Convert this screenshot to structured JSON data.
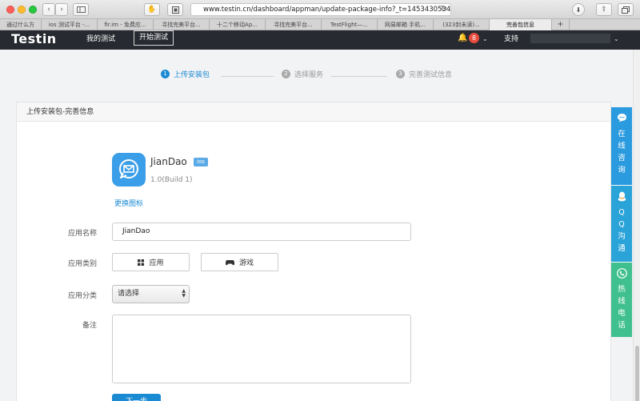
{
  "browser": {
    "url": "www.testin.cn/dashboard/appman/update-package-info?_t=1453430534&app_",
    "tabs": [
      {
        "label": "通过什么方",
        "width": 52
      },
      {
        "label": "ios 测试平台 -...",
        "width": 70
      },
      {
        "label": "fir.im - 免费应...",
        "width": 70
      },
      {
        "label": "寻找完美平台...",
        "width": 70
      },
      {
        "label": "十二个移动Ap...",
        "width": 70
      },
      {
        "label": "寻找完美平台...",
        "width": 70
      },
      {
        "label": "TestFlight—...",
        "width": 70
      },
      {
        "label": "网易邮箱 手机...",
        "width": 70
      },
      {
        "label": "(323封未读)...",
        "width": 70
      },
      {
        "label": "完善包信息",
        "width": 78,
        "active": true
      }
    ],
    "new_tab": "+"
  },
  "header": {
    "logo": "Testin",
    "my_tests": "我的测试",
    "start_test": "开始测试",
    "notification_count": "8",
    "support": "支持"
  },
  "steps": [
    {
      "num": "1",
      "label": "上传安装包",
      "active": true
    },
    {
      "num": "2",
      "label": "选择服务",
      "active": false
    },
    {
      "num": "3",
      "label": "完善测试信息",
      "active": false
    }
  ],
  "panel": {
    "title": "上传安装包-完善信息",
    "app_name": "JianDao",
    "platform_tag": "ios",
    "version": "1.0(Build 1)",
    "change_icon": "更换图标",
    "form": {
      "name_label": "应用名称",
      "name_value": "JianDao",
      "category_label": "应用类别",
      "category_app": "应用",
      "category_game": "游戏",
      "classify_label": "应用分类",
      "classify_value": "请选择",
      "remark_label": "备注",
      "next_button": "下一步"
    }
  },
  "side": {
    "online": "在线咨询",
    "qq": "QQ沟通",
    "hotline": "热线电话",
    "colors": {
      "online": "#2b9be0",
      "qq": "#2aa3d8",
      "hotline": "#3fc08e"
    }
  }
}
